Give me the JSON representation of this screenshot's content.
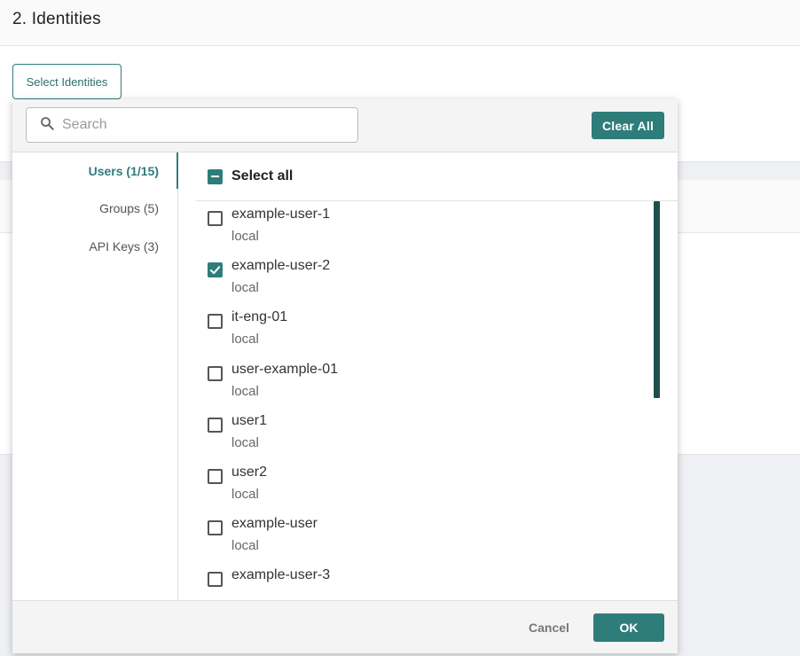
{
  "section": {
    "title": "2. Identities",
    "select_button": "Select Identities"
  },
  "popover": {
    "search_placeholder": "Search",
    "clear_all": "Clear All",
    "tabs": [
      {
        "label": "Users (1/15)",
        "active": true
      },
      {
        "label": "Groups (5)",
        "active": false
      },
      {
        "label": "API Keys (3)",
        "active": false
      }
    ],
    "select_all": {
      "label": "Select all",
      "state": "indeterminate"
    },
    "items": [
      {
        "name": "example-user-1",
        "source": "local",
        "checked": false
      },
      {
        "name": "example-user-2",
        "source": "local",
        "checked": true
      },
      {
        "name": "it-eng-01",
        "source": "local",
        "checked": false
      },
      {
        "name": "user-example-01",
        "source": "local",
        "checked": false
      },
      {
        "name": "user1",
        "source": "local",
        "checked": false
      },
      {
        "name": "user2",
        "source": "local",
        "checked": false
      },
      {
        "name": "example-user",
        "source": "local",
        "checked": false
      },
      {
        "name": "example-user-3",
        "source": "",
        "checked": false
      }
    ],
    "cancel": "Cancel",
    "ok": "OK"
  },
  "colors": {
    "accent": "#2e7d7a",
    "scrollbar": "#1f4f4c"
  },
  "icons": {
    "search": "search-icon",
    "check": "checkmark-icon"
  }
}
